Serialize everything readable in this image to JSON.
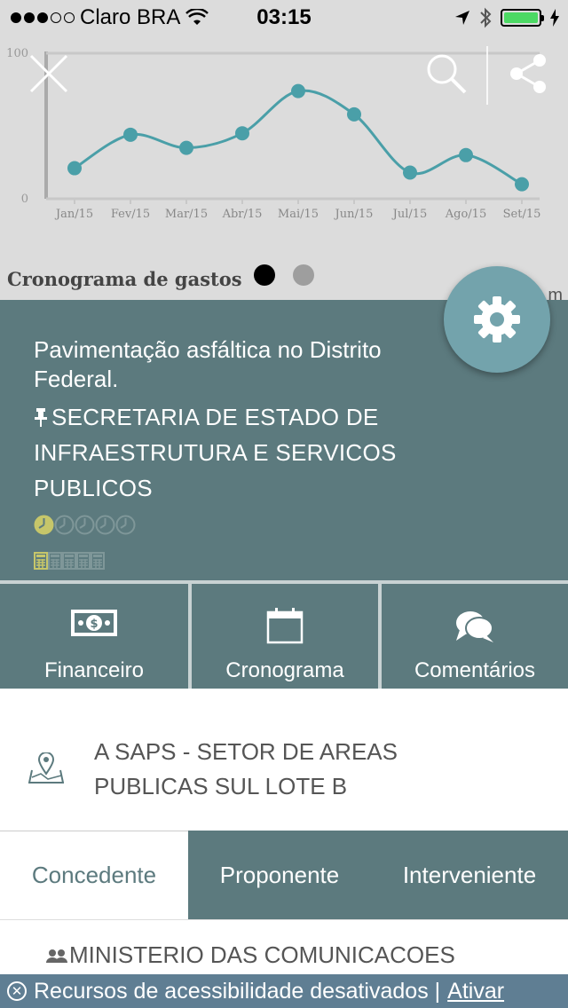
{
  "status_bar": {
    "carrier": "Claro BRA",
    "time": "03:15"
  },
  "chart_data": {
    "type": "line",
    "categories": [
      "Jan/15",
      "Fev/15",
      "Mar/15",
      "Abr/15",
      "Mai/15",
      "Jun/15",
      "Jul/15",
      "Ago/15",
      "Set/15"
    ],
    "series": [
      {
        "values": [
          21,
          44,
          35,
          45,
          74,
          58,
          18,
          30,
          10
        ],
        "color": "#4a9fa8"
      }
    ],
    "ylim": [
      0,
      100
    ],
    "ytick_labels": [
      "0",
      "100"
    ],
    "title": "Cronograma de gastos",
    "grid": false
  },
  "pager": {
    "count": 2,
    "active": 0
  },
  "clipped_text": "Con            m",
  "project": {
    "title": "Pavimentação asfáltica no Distrito Federal.",
    "pin_icon": "pin-icon",
    "organization": "SECRETARIA DE ESTADO DE INFRAESTRUTURA E SERVICOS PUBLICOS",
    "timeliness_rating": {
      "filled": 1,
      "total": 5
    },
    "budget_rating": {
      "filled": 1,
      "total": 5
    }
  },
  "tabs": [
    {
      "label": "Financeiro",
      "icon": "money-icon"
    },
    {
      "label": "Cronograma",
      "icon": "calendar-icon"
    },
    {
      "label": "Comentários",
      "icon": "comments-icon"
    }
  ],
  "address": {
    "icon": "map-icon",
    "text": "A SAPS - SETOR DE AREAS PUBLICAS SUL LOTE B"
  },
  "role_tabs": [
    {
      "label": "Concedente",
      "selected": true
    },
    {
      "label": "Proponente",
      "selected": false
    },
    {
      "label": "Interveniente",
      "selected": false
    }
  ],
  "ministry": {
    "icon": "people-icon",
    "name": "MINISTERIO DAS COMUNICACOES"
  },
  "accessibility_banner": {
    "text": "Recursos de acessibilidade desativados |",
    "action": "Ativar"
  },
  "colors": {
    "panel": "#5c7a7e",
    "chart_bg": "#dcdcdc",
    "line": "#4a9fa8",
    "fab": "#73a3ac",
    "rating_active": "#c6c66a",
    "banner": "#5f7e93"
  }
}
